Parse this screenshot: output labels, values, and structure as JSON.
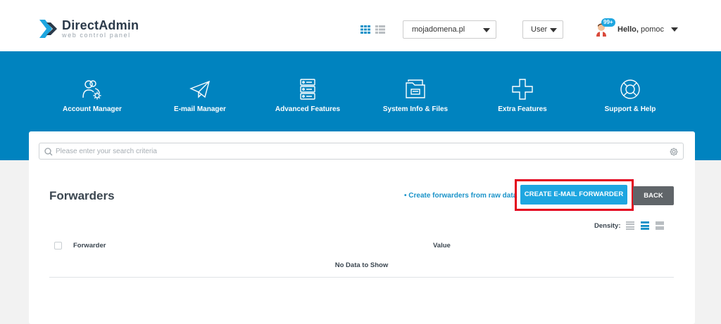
{
  "header": {
    "logo_name": "DirectAdmin",
    "logo_sub": "web control panel",
    "domain_value": "mojadomena.pl",
    "role_value": "User",
    "notification_badge": "99+",
    "greeting": "Hello,",
    "username": "pomoc",
    "accent_color": "#1ea6e0"
  },
  "nav": {
    "band_color": "#0083bf",
    "items": [
      {
        "label": "Account Manager",
        "icon": "users-gear-icon"
      },
      {
        "label": "E-mail Manager",
        "icon": "paper-plane-icon"
      },
      {
        "label": "Advanced Features",
        "icon": "server-icon"
      },
      {
        "label": "System Info & Files",
        "icon": "folder-icon"
      },
      {
        "label": "Extra Features",
        "icon": "plus-icon"
      },
      {
        "label": "Support & Help",
        "icon": "lifebuoy-icon"
      }
    ]
  },
  "search": {
    "placeholder": "Please enter your search criteria"
  },
  "page": {
    "title": "Forwarders",
    "raw_link": "• Create forwarders from raw data",
    "create_button": "CREATE E-MAIL FORWARDER",
    "back_button": "BACK",
    "density_label": "Density:"
  },
  "table": {
    "columns": [
      "Forwarder",
      "Value"
    ],
    "empty_text": "No Data to Show"
  }
}
